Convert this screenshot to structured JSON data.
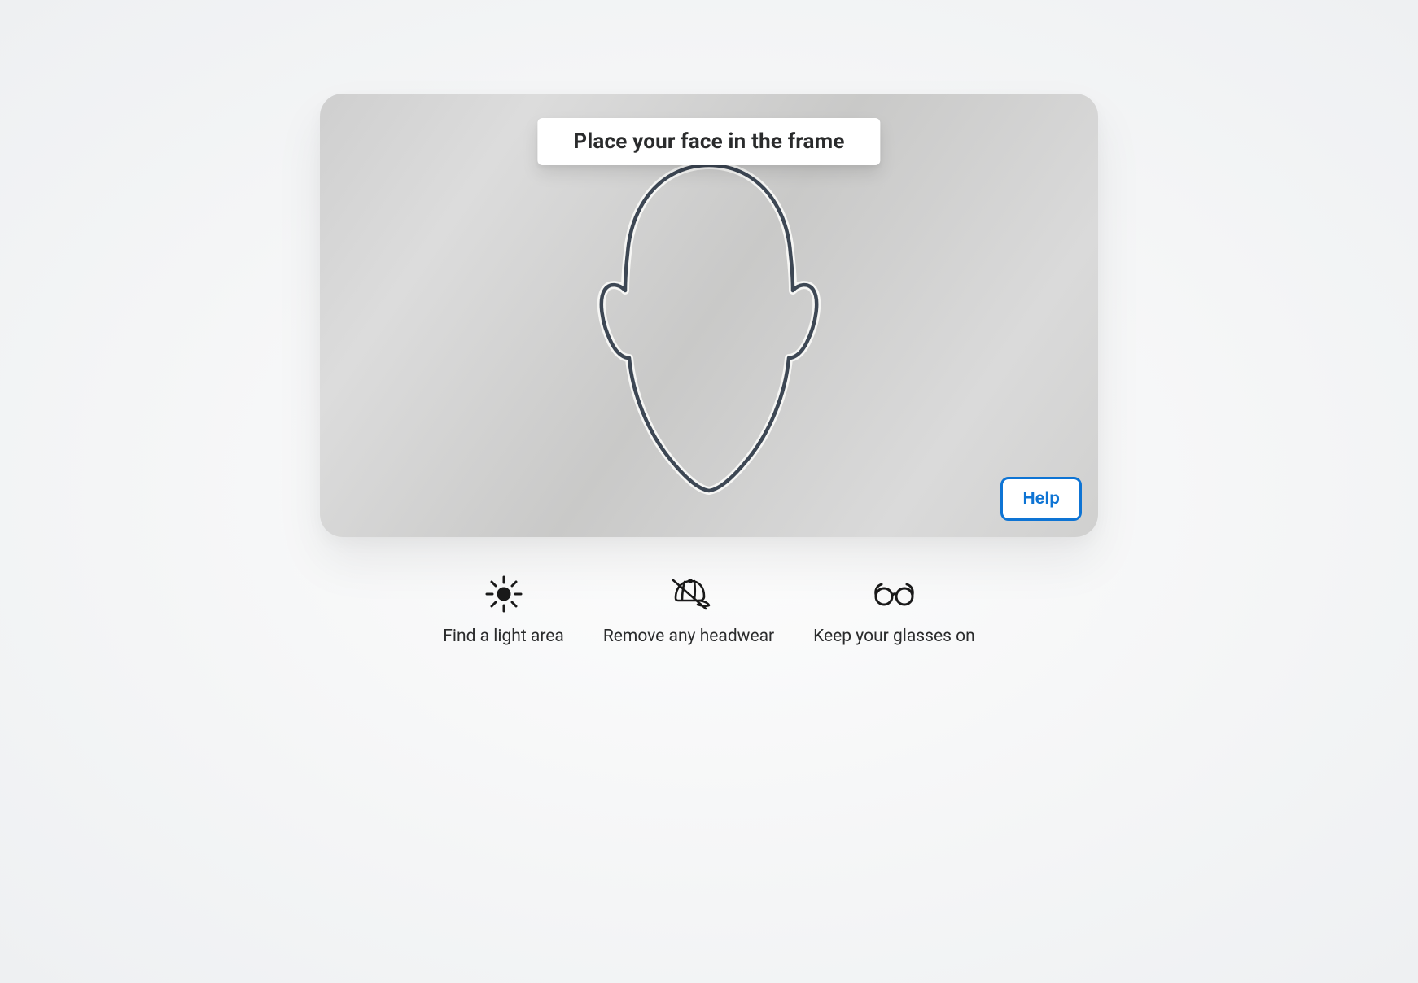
{
  "instruction": "Place your face in the frame",
  "help_label": "Help",
  "tips": [
    {
      "icon": "sun-icon",
      "label": "Find a light area"
    },
    {
      "icon": "no-hat-icon",
      "label": "Remove any headwear"
    },
    {
      "icon": "glasses-icon",
      "label": "Keep your glasses on"
    }
  ],
  "colors": {
    "accent": "#0e74d4",
    "text": "#2a2b2c",
    "outline": "#3d4754"
  }
}
